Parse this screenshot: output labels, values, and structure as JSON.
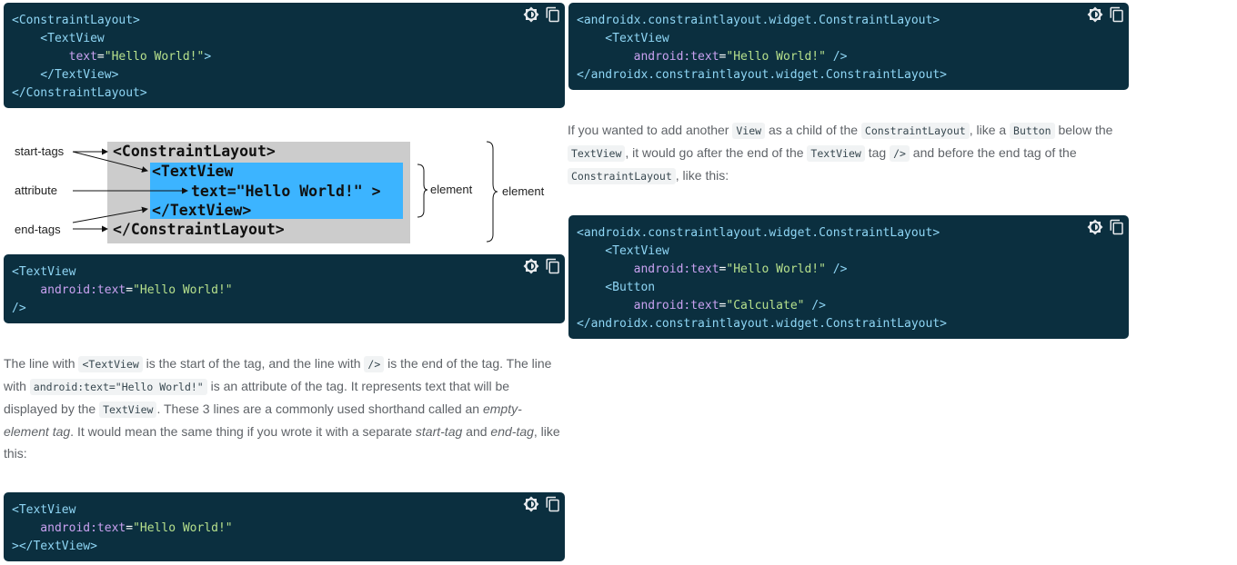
{
  "code_blocks": {
    "block1": {
      "lines": [
        [
          {
            "t": "tag",
            "v": "<ConstraintLayout>"
          }
        ],
        [
          {
            "t": "tag",
            "v": "    <TextView"
          }
        ],
        [
          {
            "t": "attr",
            "v": "        text"
          },
          {
            "t": "punc",
            "v": "="
          },
          {
            "t": "str",
            "v": "\"Hello World!\""
          },
          {
            "t": "tag",
            "v": ">"
          }
        ],
        [
          {
            "t": "tag",
            "v": "    </TextView>"
          }
        ],
        [
          {
            "t": "tag",
            "v": "</ConstraintLayout>"
          }
        ]
      ]
    },
    "block2": {
      "lines": [
        [
          {
            "t": "tag",
            "v": "<TextView"
          }
        ],
        [
          {
            "t": "attr",
            "v": "    android:text"
          },
          {
            "t": "punc",
            "v": "="
          },
          {
            "t": "str",
            "v": "\"Hello World!\""
          }
        ],
        [
          {
            "t": "tag",
            "v": "/>"
          }
        ]
      ]
    },
    "block3": {
      "lines": [
        [
          {
            "t": "tag",
            "v": "<TextView"
          }
        ],
        [
          {
            "t": "attr",
            "v": "    android:text"
          },
          {
            "t": "punc",
            "v": "="
          },
          {
            "t": "str",
            "v": "\"Hello World!\""
          }
        ],
        [
          {
            "t": "tag",
            "v": "></TextView>"
          }
        ]
      ]
    },
    "block4": {
      "lines": [
        [
          {
            "t": "tag",
            "v": "<androidx.constraintlayout.widget.ConstraintLayout>"
          }
        ],
        [
          {
            "t": "tag",
            "v": "    <TextView"
          }
        ],
        [
          {
            "t": "attr",
            "v": "        android:text"
          },
          {
            "t": "punc",
            "v": "="
          },
          {
            "t": "str",
            "v": "\"Hello World!\""
          },
          {
            "t": "tag",
            "v": " />"
          }
        ],
        [
          {
            "t": "tag",
            "v": "</androidx.constraintlayout.widget.ConstraintLayout>"
          }
        ]
      ]
    },
    "block5": {
      "lines": [
        [
          {
            "t": "tag",
            "v": "<androidx.constraintlayout.widget.ConstraintLayout>"
          }
        ],
        [
          {
            "t": "tag",
            "v": "    <TextView"
          }
        ],
        [
          {
            "t": "attr",
            "v": "        android:text"
          },
          {
            "t": "punc",
            "v": "="
          },
          {
            "t": "str",
            "v": "\"Hello World!\""
          },
          {
            "t": "tag",
            "v": " />"
          }
        ],
        [
          {
            "t": "tag",
            "v": "    <Button"
          }
        ],
        [
          {
            "t": "attr",
            "v": "        android:text"
          },
          {
            "t": "punc",
            "v": "="
          },
          {
            "t": "str",
            "v": "\"Calculate\""
          },
          {
            "t": "tag",
            "v": " />"
          }
        ],
        [
          {
            "t": "tag",
            "v": "</androidx.constraintlayout.widget.ConstraintLayout>"
          }
        ]
      ]
    }
  },
  "code_icons": {
    "theme": "brightness-icon",
    "copy": "copy-icon"
  },
  "diagram": {
    "code_lines": [
      "<ConstraintLayout>",
      "<TextView",
      "text=\"Hello World!\" >",
      "</TextView>",
      "</ConstraintLayout>"
    ],
    "labels": {
      "start_tags": "start-tags",
      "attribute": "attribute",
      "end_tags": "end-tags",
      "element_inner": "element",
      "element_outer": "element"
    }
  },
  "para1": {
    "p1": "The line with ",
    "c1": "<TextView",
    "p2": " is the start of the tag, and the line with ",
    "c2": "/>",
    "p3": " is the end of the tag. The line with ",
    "c3": "android:text=\"Hello World!\"",
    "p4": " is an attribute of the tag. It represents text that will be displayed by the ",
    "c4": "TextView",
    "p5": ". These 3 lines are a commonly used shorthand called an ",
    "e1": "empty-element tag",
    "p6": ". It would mean the same thing if you wrote it with a separate ",
    "e2": "start-tag",
    "p7": " and ",
    "e3": "end-tag",
    "p8": ", like this:"
  },
  "para2": {
    "p1": "If you wanted to add another ",
    "c1": "View",
    "p2": " as a child of the ",
    "c2": "ConstraintLayout",
    "p3": ", like a ",
    "c3": "Button",
    "p4": " below the ",
    "c4": "TextView",
    "p5": ", it would go after the end of the ",
    "c5": "TextView",
    "p6": " tag ",
    "c6": "/>",
    "p7": " and before the end tag of the ",
    "c7": "ConstraintLayout",
    "p8": ", like this:"
  }
}
